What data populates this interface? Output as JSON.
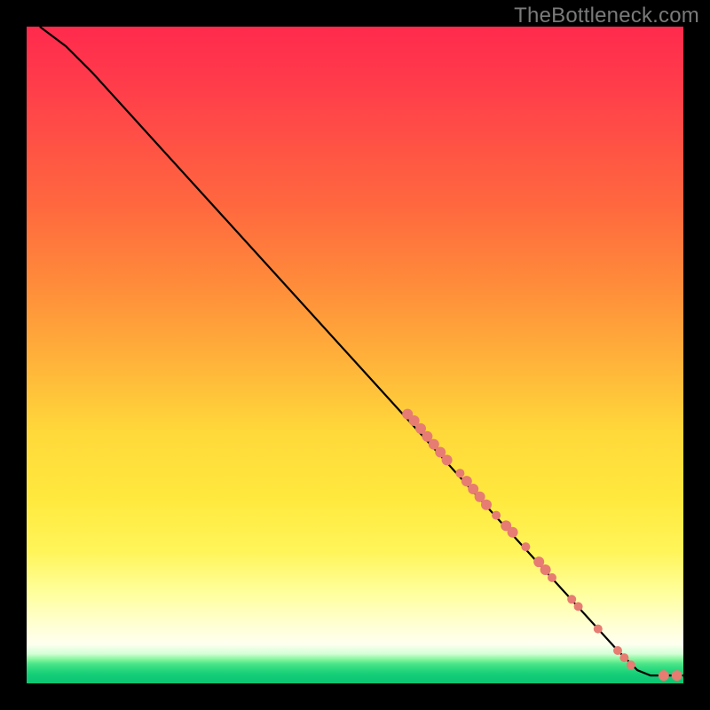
{
  "watermark": "TheBottleneck.com",
  "chart_data": {
    "type": "line",
    "title": "",
    "xlabel": "",
    "ylabel": "",
    "xlim": [
      0,
      100
    ],
    "ylim": [
      0,
      100
    ],
    "background": "red-yellow-green vertical gradient",
    "curve": [
      {
        "x": 2,
        "y": 100
      },
      {
        "x": 6,
        "y": 97
      },
      {
        "x": 10,
        "y": 93
      },
      {
        "x": 20,
        "y": 82
      },
      {
        "x": 30,
        "y": 71
      },
      {
        "x": 40,
        "y": 60
      },
      {
        "x": 50,
        "y": 49
      },
      {
        "x": 60,
        "y": 38
      },
      {
        "x": 70,
        "y": 27
      },
      {
        "x": 80,
        "y": 16
      },
      {
        "x": 90,
        "y": 5
      },
      {
        "x": 93,
        "y": 2
      },
      {
        "x": 95,
        "y": 1.2
      },
      {
        "x": 100,
        "y": 1.2
      }
    ],
    "points": [
      {
        "x": 58,
        "y": 41,
        "r": 6
      },
      {
        "x": 59,
        "y": 40,
        "r": 6
      },
      {
        "x": 60,
        "y": 38.8,
        "r": 6
      },
      {
        "x": 61,
        "y": 37.6,
        "r": 6
      },
      {
        "x": 62,
        "y": 36.4,
        "r": 6
      },
      {
        "x": 63,
        "y": 35.2,
        "r": 6
      },
      {
        "x": 64,
        "y": 34,
        "r": 6
      },
      {
        "x": 66,
        "y": 32,
        "r": 5
      },
      {
        "x": 67,
        "y": 30.8,
        "r": 6
      },
      {
        "x": 68,
        "y": 29.6,
        "r": 6
      },
      {
        "x": 69,
        "y": 28.4,
        "r": 6
      },
      {
        "x": 70,
        "y": 27.2,
        "r": 6
      },
      {
        "x": 71.5,
        "y": 25.6,
        "r": 5
      },
      {
        "x": 73,
        "y": 24,
        "r": 6
      },
      {
        "x": 74,
        "y": 23,
        "r": 6
      },
      {
        "x": 76,
        "y": 20.8,
        "r": 5
      },
      {
        "x": 78,
        "y": 18.5,
        "r": 6
      },
      {
        "x": 79,
        "y": 17.3,
        "r": 6
      },
      {
        "x": 80,
        "y": 16.1,
        "r": 5
      },
      {
        "x": 83,
        "y": 12.8,
        "r": 5
      },
      {
        "x": 84,
        "y": 11.7,
        "r": 5
      },
      {
        "x": 87,
        "y": 8.3,
        "r": 5
      },
      {
        "x": 90,
        "y": 5,
        "r": 5
      },
      {
        "x": 91,
        "y": 3.9,
        "r": 5
      },
      {
        "x": 92,
        "y": 2.8,
        "r": 5
      },
      {
        "x": 97,
        "y": 1.2,
        "r": 6
      },
      {
        "x": 99,
        "y": 1.2,
        "r": 6
      }
    ]
  }
}
